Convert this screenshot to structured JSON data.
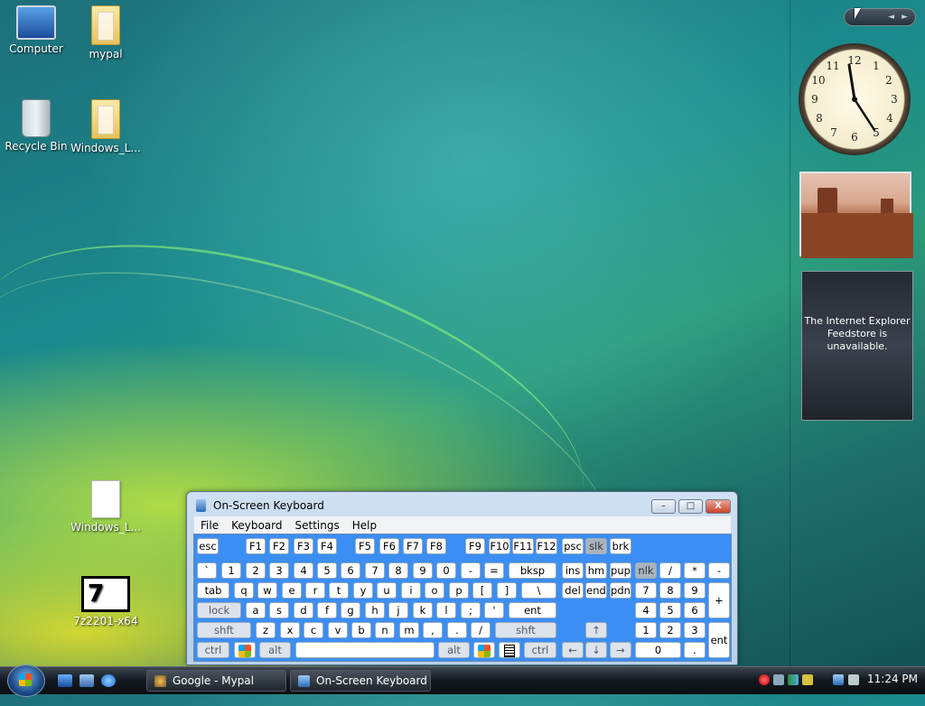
{
  "desktop": {
    "icons": [
      {
        "label": "Computer",
        "icon": "computer-icon"
      },
      {
        "label": "mypal",
        "icon": "folder-icon"
      },
      {
        "label": "Recycle Bin",
        "icon": "recycle-bin-icon"
      },
      {
        "label": "Windows_L...",
        "icon": "folder-icon"
      },
      {
        "label": "Windows_L...",
        "icon": "document-icon"
      },
      {
        "label": "7z2201-x64",
        "icon": "7zip-installer-icon"
      }
    ]
  },
  "gadgets": {
    "clock_numbers": [
      "12",
      "1",
      "2",
      "3",
      "4",
      "5",
      "6",
      "7",
      "8",
      "9",
      "10",
      "11"
    ],
    "clock_time": "11:24",
    "photo_subject": "desert-buttes",
    "feed_message": "The Internet Explorer Feedstore is unavailable."
  },
  "osk": {
    "title": "On-Screen Keyboard",
    "menu": [
      "File",
      "Keyboard",
      "Settings",
      "Help"
    ],
    "window_buttons": {
      "minimize": "–",
      "maximize": "□",
      "close": "X"
    },
    "keys": {
      "esc": "esc",
      "f1": "F1",
      "f2": "F2",
      "f3": "F3",
      "f4": "F4",
      "f5": "F5",
      "f6": "F6",
      "f7": "F7",
      "f8": "F8",
      "f9": "F9",
      "f10": "F10",
      "f11": "F11",
      "f12": "F12",
      "psc": "psc",
      "slk": "slk",
      "brk": "brk",
      "backtick": "`",
      "n1": "1",
      "n2": "2",
      "n3": "3",
      "n4": "4",
      "n5": "5",
      "n6": "6",
      "n7": "7",
      "n8": "8",
      "n9": "9",
      "n0": "0",
      "minus": "-",
      "equals": "=",
      "bksp": "bksp",
      "ins": "ins",
      "hm": "hm",
      "pup": "pup",
      "nlk": "nlk",
      "divide": "/",
      "multiply": "*",
      "subtract": "-",
      "tab": "tab",
      "q": "q",
      "w": "w",
      "e": "e",
      "r": "r",
      "t": "t",
      "y": "y",
      "u": "u",
      "i": "i",
      "o": "o",
      "p": "p",
      "lbracket": "[",
      "rbracket": "]",
      "backslash": "\\",
      "del": "del",
      "end": "end",
      "pdn": "pdn",
      "np7": "7",
      "np8": "8",
      "np9": "9",
      "plus": "+",
      "lock": "lock",
      "a": "a",
      "s": "s",
      "d": "d",
      "f": "f",
      "g": "g",
      "h": "h",
      "j": "j",
      "k": "k",
      "l": "l",
      "semicolon": ";",
      "quote": "'",
      "ent": "ent",
      "np4": "4",
      "np5": "5",
      "np6": "6",
      "shft": "shft",
      "z": "z",
      "x": "x",
      "c": "c",
      "v": "v",
      "b": "b",
      "n": "n",
      "m": "m",
      "comma": ",",
      "period": ".",
      "slash": "/",
      "shft_r": "shft",
      "up": "↑",
      "np1": "1",
      "np2": "2",
      "np3": "3",
      "ctrl": "ctrl",
      "alt": "alt",
      "alt_r": "alt",
      "ctrl_r": "ctrl",
      "left": "←",
      "down": "↓",
      "right": "→",
      "np0": "0",
      "npdot": ".",
      "npent": "ent"
    }
  },
  "taskbar": {
    "buttons": [
      {
        "label": "Google - Mypal",
        "icon": "mypal-browser-icon"
      },
      {
        "label": "On-Screen Keyboard",
        "icon": "keyboard-icon"
      }
    ],
    "clock": "11:24 PM"
  }
}
